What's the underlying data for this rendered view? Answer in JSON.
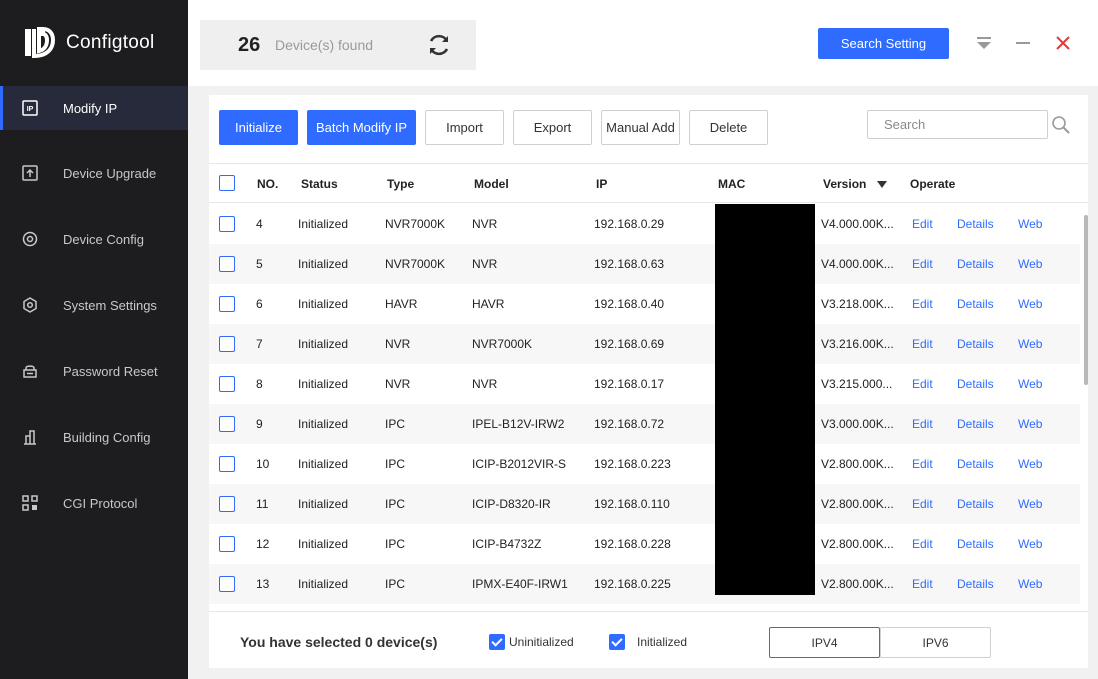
{
  "app": {
    "name": "Configtool"
  },
  "colors": {
    "accent": "#2f6bff",
    "sidebar_bg": "#1d1d1f",
    "close": "#e53935"
  },
  "sidebar": {
    "items": [
      {
        "label": "Modify IP",
        "icon": "ip-icon",
        "active": true
      },
      {
        "label": "Device Upgrade",
        "icon": "upgrade-icon",
        "active": false
      },
      {
        "label": "Device Config",
        "icon": "config-icon",
        "active": false
      },
      {
        "label": "System Settings",
        "icon": "settings-icon",
        "active": false
      },
      {
        "label": "Password Reset",
        "icon": "password-reset-icon",
        "active": false
      },
      {
        "label": "Building Config",
        "icon": "building-icon",
        "active": false
      },
      {
        "label": "CGI Protocol",
        "icon": "cgi-icon",
        "active": false
      }
    ]
  },
  "header": {
    "device_count": "26",
    "device_label": "Device(s) found",
    "search_setting_label": "Search Setting"
  },
  "toolbar": {
    "initialize": "Initialize",
    "batch_modify": "Batch Modify IP",
    "import": "Import",
    "export": "Export",
    "manual_add": "Manual Add",
    "delete": "Delete",
    "search_placeholder": "Search"
  },
  "table": {
    "columns": {
      "no": "NO.",
      "status": "Status",
      "type": "Type",
      "model": "Model",
      "ip": "IP",
      "mac": "MAC",
      "version": "Version",
      "operate": "Operate"
    },
    "actions": {
      "edit": "Edit",
      "details": "Details",
      "web": "Web"
    },
    "rows": [
      {
        "no": "4",
        "status": "Initialized",
        "type": "NVR7000K",
        "model": "NVR",
        "ip": "192.168.0.29",
        "version": "V4.000.00K..."
      },
      {
        "no": "5",
        "status": "Initialized",
        "type": "NVR7000K",
        "model": "NVR",
        "ip": "192.168.0.63",
        "version": "V4.000.00K..."
      },
      {
        "no": "6",
        "status": "Initialized",
        "type": "HAVR",
        "model": "HAVR",
        "ip": "192.168.0.40",
        "version": "V3.218.00K..."
      },
      {
        "no": "7",
        "status": "Initialized",
        "type": "NVR",
        "model": "NVR7000K",
        "ip": "192.168.0.69",
        "version": "V3.216.00K..."
      },
      {
        "no": "8",
        "status": "Initialized",
        "type": "NVR",
        "model": "NVR",
        "ip": "192.168.0.17",
        "version": "V3.215.000..."
      },
      {
        "no": "9",
        "status": "Initialized",
        "type": "IPC",
        "model": "IPEL-B12V-IRW2",
        "ip": "192.168.0.72",
        "version": "V3.000.00K..."
      },
      {
        "no": "10",
        "status": "Initialized",
        "type": "IPC",
        "model": "ICIP-B2012VIR-S",
        "ip": "192.168.0.223",
        "version": "V2.800.00K..."
      },
      {
        "no": "11",
        "status": "Initialized",
        "type": "IPC",
        "model": "ICIP-D8320-IR",
        "ip": "192.168.0.110",
        "version": "V2.800.00K..."
      },
      {
        "no": "12",
        "status": "Initialized",
        "type": "IPC",
        "model": "ICIP-B4732Z",
        "ip": "192.168.0.228",
        "version": "V2.800.00K..."
      },
      {
        "no": "13",
        "status": "Initialized",
        "type": "IPC",
        "model": "IPMX-E40F-IRW1",
        "ip": "192.168.0.225",
        "version": "V2.800.00K..."
      }
    ]
  },
  "footer": {
    "selected_text": "You have selected 0  device(s)",
    "uninitialized_label": "Uninitialized",
    "initialized_label": "Initialized",
    "ipv4": "IPV4",
    "ipv6": "IPV6"
  }
}
